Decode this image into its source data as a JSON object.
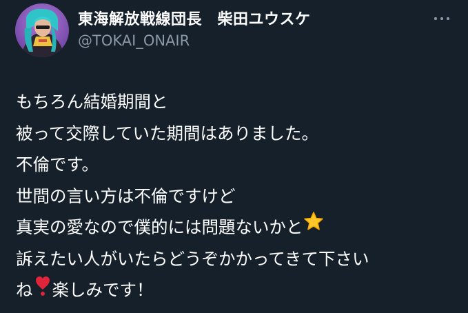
{
  "colors": {
    "background": "#15202b",
    "text": "#ffffff",
    "secondary_text": "#8b98a5",
    "heart": "#e0243a",
    "star": "#ffc62a"
  },
  "author": {
    "display_name": "東海解放戦線団長　柴田ユウスケ",
    "handle": "@TOKAI_ONAIR",
    "avatar_icon": "profile-avatar"
  },
  "actions": {
    "more_icon": "ellipsis-icon"
  },
  "tweet": {
    "lines": [
      {
        "text": "もちろん結婚期間と"
      },
      {
        "text": "被って交際していた期間はありました。"
      },
      {
        "text": "不倫です。"
      },
      {
        "text": "世間の言い方は不倫ですけど"
      },
      {
        "text": "真実の愛なので僕的には問題ないかと",
        "emoji_after": "star-emoji"
      },
      {
        "text": "訴えたい人がいたらどうぞかかってきて下さい"
      },
      {
        "text_before": "ね",
        "emoji_mid": "heart-exclamation-emoji",
        "text_after": "楽しみです！"
      }
    ]
  }
}
